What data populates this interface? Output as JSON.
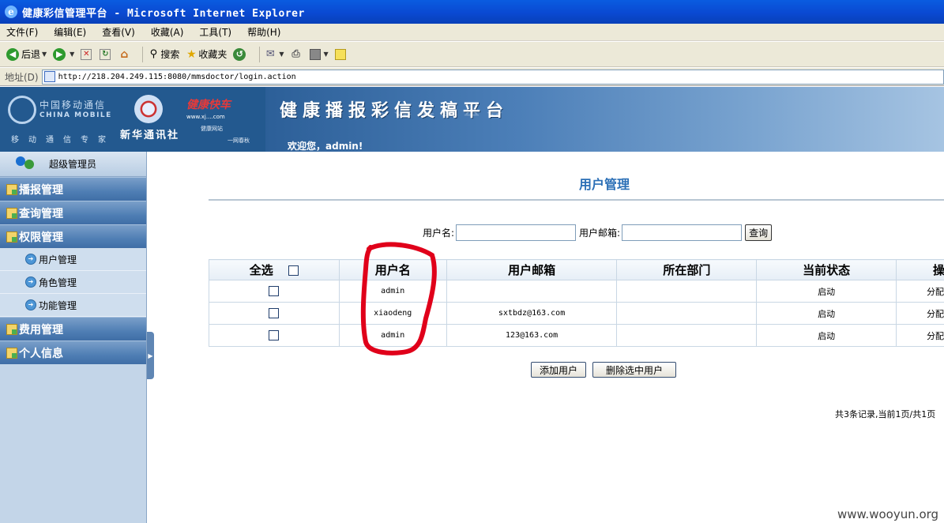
{
  "window": {
    "title": "健康彩信管理平台 - Microsoft Internet Explorer"
  },
  "menu": [
    "文件(F)",
    "编辑(E)",
    "查看(V)",
    "收藏(A)",
    "工具(T)",
    "帮助(H)"
  ],
  "toolbar": {
    "back": "后退",
    "search": "搜索",
    "favorites": "收藏夹"
  },
  "address": {
    "label": "地址(D)",
    "url": "http://218.204.249.115:8080/mmsdoctor/login.action"
  },
  "banner": {
    "cm_cn": "中国移动通信",
    "cm_en": "CHINA MOBILE",
    "cm_slogan": "移动通信专家",
    "xinhua": "新华通讯社",
    "red_logo": "健康快车",
    "red_sub": "www.xj....com",
    "tiny1": "健康网站",
    "tiny2": "一网春秋",
    "title": "健康播报彩信发稿平台",
    "welcome": "欢迎您，admin!"
  },
  "sidebar": {
    "user_role": "超级管理员",
    "categories": {
      "broadcast": "播报管理",
      "query": "查询管理",
      "permission": "权限管理",
      "fees": "费用管理",
      "personal": "个人信息"
    },
    "sub_items": [
      "用户管理",
      "角色管理",
      "功能管理"
    ]
  },
  "main": {
    "heading": "用户管理",
    "search": {
      "username_label": "用户名:",
      "email_label": "用户邮箱:",
      "username_value": "",
      "email_value": "",
      "query_button": "查询"
    },
    "table": {
      "headers": [
        "全选",
        "用户名",
        "用户邮箱",
        "所在部门",
        "当前状态",
        "操"
      ],
      "rows": [
        {
          "username": "admin",
          "email": "",
          "dept": "",
          "status": "启动",
          "action": "分配"
        },
        {
          "username": "xiaodeng",
          "email": "sxtbdz@163.com",
          "dept": "",
          "status": "启动",
          "action": "分配"
        },
        {
          "username": "admin",
          "email": "123@163.com",
          "dept": "",
          "status": "启动",
          "action": "分配"
        }
      ]
    },
    "add_button": "添加用户",
    "delete_button": "删除选中用户",
    "pagination": "共3条记录,当前1页/共1页"
  },
  "watermark": "www.wooyun.org",
  "colors": {
    "annotation": "#e0001a",
    "heading": "#2b6fb6"
  }
}
